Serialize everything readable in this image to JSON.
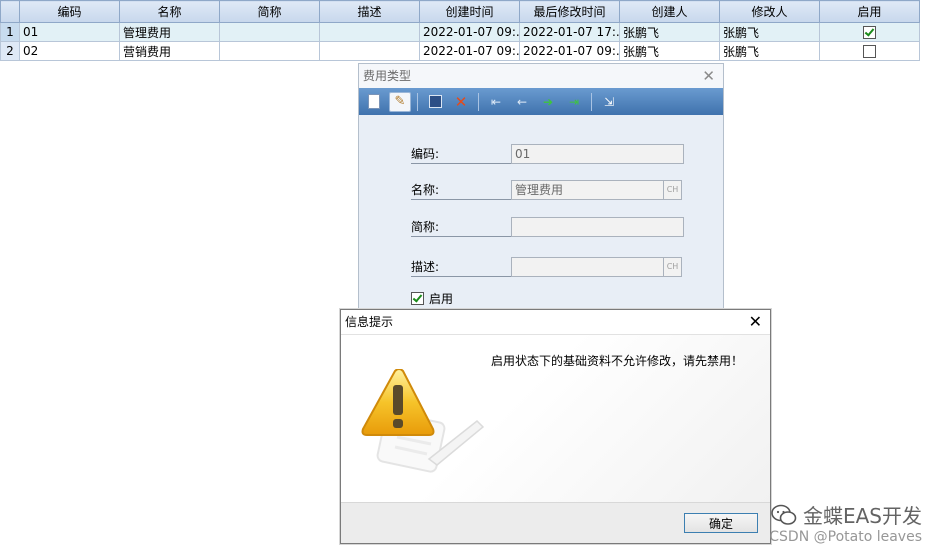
{
  "grid": {
    "columns": [
      "编码",
      "名称",
      "简称",
      "描述",
      "创建时间",
      "最后修改时间",
      "创建人",
      "修改人",
      "启用"
    ],
    "rows": [
      {
        "index": "1",
        "code": "01",
        "name": "管理费用",
        "short": "",
        "desc": "",
        "created": "2022-01-07 09:...",
        "modified": "2022-01-07 17:...",
        "creator": "张鹏飞",
        "modifier": "张鹏飞",
        "enabled": true
      },
      {
        "index": "2",
        "code": "02",
        "name": "营销费用",
        "short": "",
        "desc": "",
        "created": "2022-01-07 09:...",
        "modified": "2022-01-07 09:...",
        "creator": "张鹏飞",
        "modifier": "张鹏飞",
        "enabled": false
      }
    ]
  },
  "editor": {
    "title": "费用类型",
    "close_icon": "close-icon",
    "toolbar": [
      "new-doc-icon",
      "edit-icon",
      "save-icon",
      "delete-icon",
      "first-icon",
      "prev-icon",
      "next-icon",
      "last-icon",
      "exit-icon"
    ],
    "fields": {
      "code_label": "编码:",
      "code_value": "01",
      "name_label": "名称:",
      "name_value": "管理费用",
      "short_label": "简称:",
      "short_value": "",
      "desc_label": "描述:",
      "desc_value": "",
      "ch_label": "CH"
    },
    "enable_label": "启用",
    "enabled": true
  },
  "msgbox": {
    "title": "信息提示",
    "message": "启用状态下的基础资料不允许修改，请先禁用！",
    "ok_label": "确定",
    "icon": "warning-icon"
  },
  "watermark": {
    "line1": "金蝶EAS开发",
    "line2": "CSDN @Potato leaves"
  },
  "colors": {
    "toolbar": "#3f72ad",
    "selected_row": "#e2f1f6",
    "warning": "#f2b215"
  }
}
